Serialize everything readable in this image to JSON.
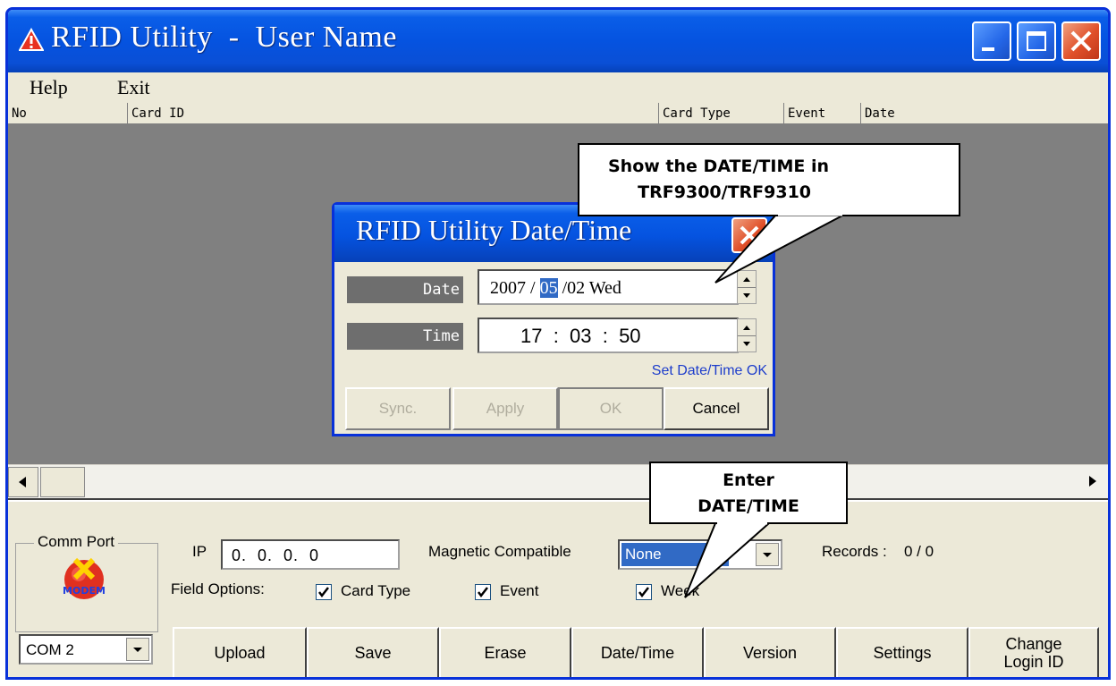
{
  "window": {
    "title": "RFID Utility  -  User Name",
    "title_icon": "warning-triangle-icon"
  },
  "menu": {
    "help": "Help",
    "exit": "Exit"
  },
  "list": {
    "columns": [
      "No",
      "Card ID",
      "Card Type",
      "Event",
      "Date"
    ]
  },
  "dialog": {
    "title": "RFID Utility Date/Time",
    "date_label": "Date",
    "date_year": "2007 / ",
    "date_month": "05",
    "date_rest": " /02 Wed",
    "time_label": "Time",
    "time_value": "17  :  03  :  50",
    "status": "Set Date/Time OK",
    "buttons": {
      "sync": "Sync.",
      "apply": "Apply",
      "ok": "OK",
      "cancel": "Cancel"
    }
  },
  "bottom": {
    "comm_port_label": "Comm Port",
    "modem_icon_text": "MODEM",
    "comm_port_value": "COM 2",
    "ip_label": "IP",
    "ip_value": "0.  0.  0.  0",
    "magnetic_label": "Magnetic Compatible",
    "magnetic_value": "None",
    "records_label": "Records : ",
    "records_value": "0 / 0",
    "field_options_label": "Field Options:",
    "field_options": [
      {
        "label": "Card Type",
        "checked": true
      },
      {
        "label": "Event",
        "checked": true
      },
      {
        "label": "Week",
        "checked": true
      }
    ],
    "buttons": [
      "Upload",
      "Save",
      "Erase",
      "Date/Time",
      "Version",
      "Settings",
      "Change Login ID"
    ]
  },
  "callouts": {
    "show_datetime": "Show the DATE/TIME in\n  TRF9300/TRF9310",
    "enter_datetime": "Enter\nDATE/TIME"
  },
  "colors": {
    "titlebar": "#0553e0",
    "window_bg": "#ece9d8",
    "list_bg": "#808080",
    "selection": "#316ac5",
    "status_text": "#1e3ecb",
    "close_button": "#e0502a"
  }
}
